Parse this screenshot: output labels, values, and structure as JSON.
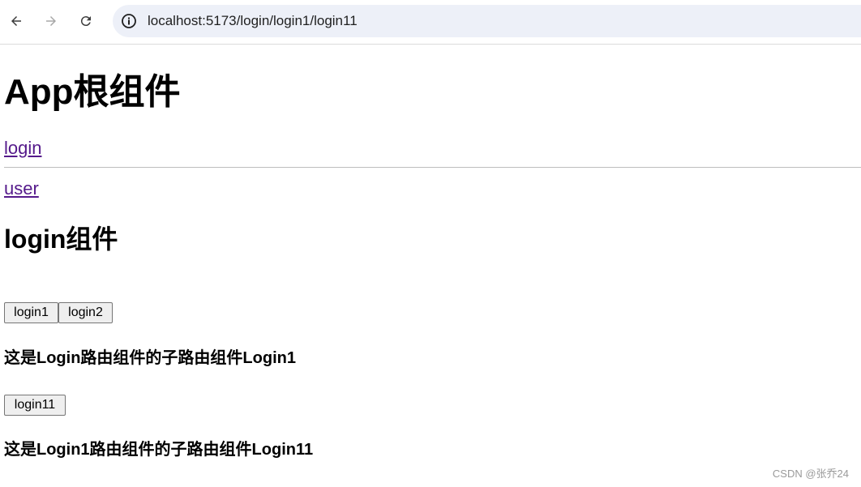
{
  "browser": {
    "url": "localhost:5173/login/login1/login11",
    "icons": {
      "back": "arrow-left-icon",
      "forward": "arrow-right-icon",
      "reload": "reload-icon",
      "site_info": "info-icon"
    }
  },
  "page": {
    "app_title": "App根组件",
    "links": {
      "login": "login",
      "user": "user"
    },
    "login_title": "login组件",
    "buttons": {
      "login1": "login1",
      "login2": "login2"
    },
    "login1_text": "这是Login路由组件的子路由组件Login1",
    "button_login11": "login11",
    "login11_text": "这是Login1路由组件的子路由组件Login11"
  },
  "watermark": "CSDN @张乔24",
  "colors": {
    "visited_link": "#551a8b",
    "omnibox_bg": "#edf0f8"
  }
}
